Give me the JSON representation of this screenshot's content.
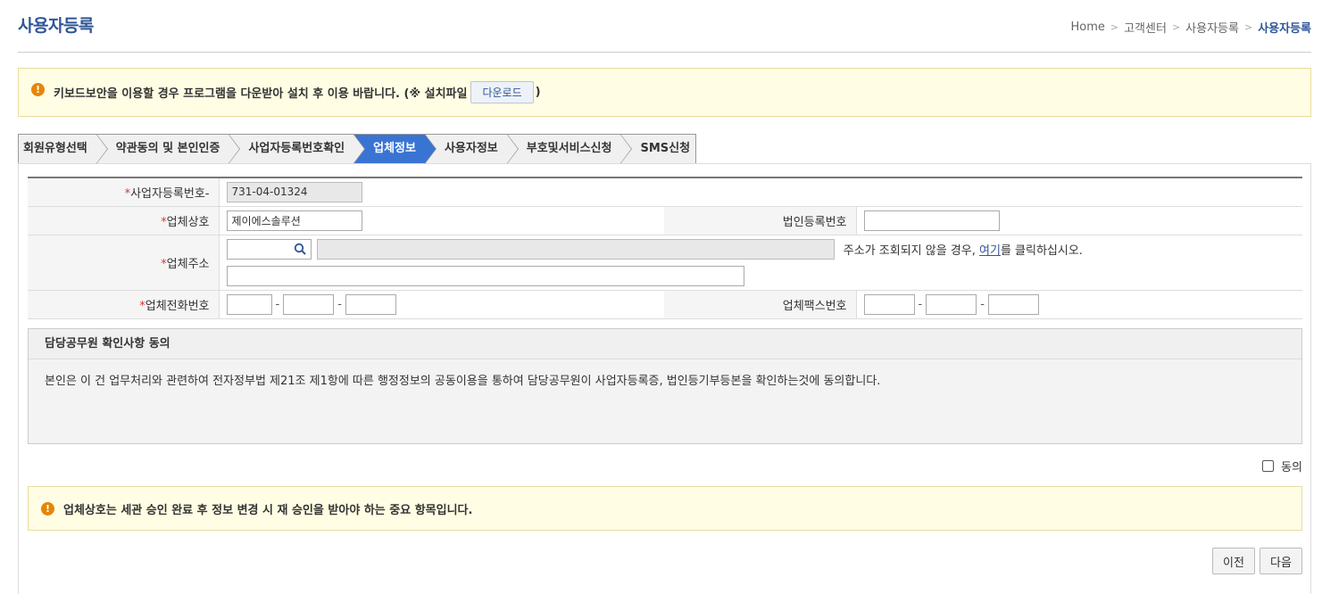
{
  "header": {
    "title": "사용자등록",
    "breadcrumb": [
      "Home",
      "고객센터",
      "사용자등록",
      "사용자등록"
    ]
  },
  "notice_top": {
    "text": "키보드보안을 이용할 경우 프로그램을 다운받아 설치 후 이용 바랍니다. (※ 설치파일",
    "button": "다운로드",
    "suffix": ")"
  },
  "steps": [
    {
      "label": "회원유형선택",
      "active": false
    },
    {
      "label": "약관동의 및 본인인증",
      "active": false
    },
    {
      "label": "사업자등록번호확인",
      "active": false
    },
    {
      "label": "업체정보",
      "active": true
    },
    {
      "label": "사용자정보",
      "active": false
    },
    {
      "label": "부호및서비스신청",
      "active": false
    },
    {
      "label": "SMS신청",
      "active": false
    }
  ],
  "form": {
    "required_mark": "*",
    "biz_no_label": "사업자등록번호-",
    "biz_no_value": "731-04-01324",
    "company_name_label": "업체상호",
    "company_name_value": "제이에스솔루션",
    "corp_reg_label": "법인등록번호",
    "corp_reg_value": "",
    "address_label": "업체주소",
    "address_help_prefix": "주소가 조회되지 않을 경우,",
    "address_help_link": "여기",
    "address_help_suffix": "를 클릭하십시오.",
    "phone_label": "업체전화번호",
    "fax_label": "업체팩스번호",
    "dash": "-"
  },
  "consent": {
    "title": "담당공무원 확인사항 동의",
    "body": "본인은 이 건 업무처리와 관련하여 전자정부법 제21조 제1항에 따른 행정정보의 공동이용을 통하여 담당공무원이 사업자등록증, 법인등기부등본을 확인하는것에 동의합니다.",
    "agree_label": "동의",
    "agreed": false
  },
  "notice_bottom": {
    "text": "업체상호는 세관 승인 완료 후 정보 변경 시 재 승인을 받아야 하는 중요 항목입니다."
  },
  "buttons": {
    "prev": "이전",
    "next": "다음"
  },
  "colors": {
    "accent": "#3a74d3",
    "title": "#2f5597",
    "notice_bg": "#fffde3",
    "warn": "#e4860b"
  }
}
